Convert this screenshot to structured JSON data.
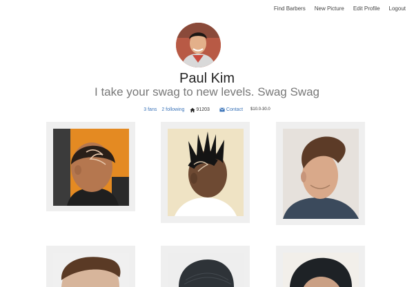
{
  "nav": {
    "items": [
      "Find Barbers",
      "New Picture",
      "Edit Profile",
      "Logout"
    ]
  },
  "profile": {
    "name": "Paul Kim",
    "tagline": "I take your swag to new levels. Swag Swag"
  },
  "stats": {
    "fans": "3 fans",
    "following": "2 following",
    "zip": "91203",
    "contact": "Contact",
    "price": "$10.0-30.0"
  },
  "icons": {
    "home": "home-icon",
    "contact": "envelope-icon",
    "price": "dollar-icon"
  },
  "colors": {
    "link": "#3a73b8",
    "card_bg": "#efefef"
  }
}
